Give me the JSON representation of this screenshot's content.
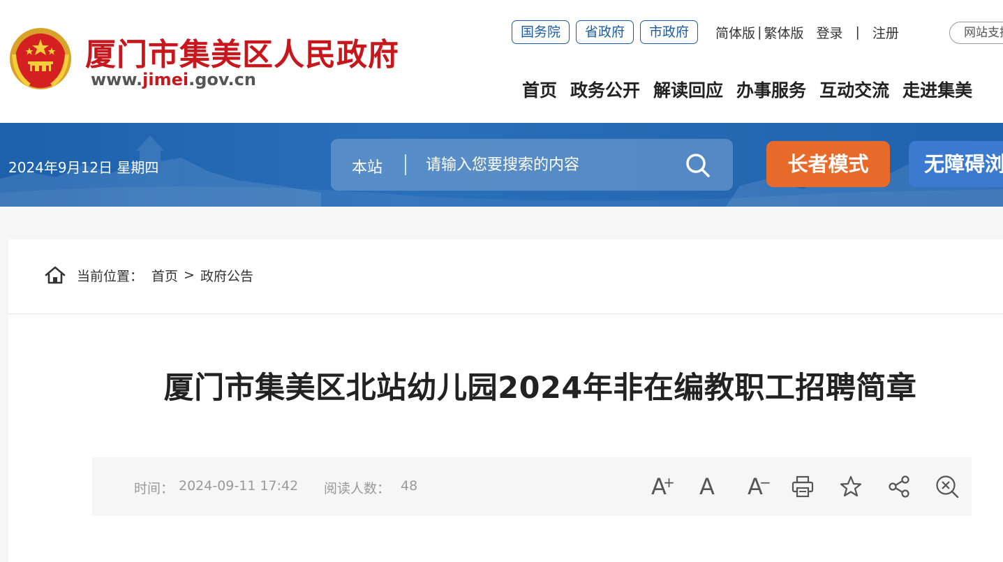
{
  "header": {
    "site_name": "厦门市集美区人民政府",
    "site_url_prefix": "www.",
    "site_url_highlight": "jimei",
    "site_url_suffix": ".gov.cn",
    "gov_links": [
      "国务院",
      "省政府",
      "市政府"
    ],
    "lang_simplified": "简体版",
    "lang_separator": "|",
    "lang_traditional": "繁体版",
    "login": "登录",
    "auth_separator": "|",
    "register": "注册",
    "support": "网站支持",
    "nav": [
      "首页",
      "政务公开",
      "解读回应",
      "办事服务",
      "互动交流",
      "走进集美"
    ]
  },
  "banner": {
    "date": "2024年9月12日 星期四",
    "search_scope": "本站",
    "search_placeholder": "请输入您要搜索的内容",
    "elder_mode": "长者模式",
    "accessibility": "无障碍浏览"
  },
  "breadcrumb": {
    "label": "当前位置：",
    "home": "首页",
    "arrow": ">",
    "current": "政府公告"
  },
  "article": {
    "title": "厦门市集美区北站幼儿园2024年非在编教职工招聘简章",
    "time_label": "时间：",
    "time": "2024-09-11 17:42",
    "read_label": "阅读人数：",
    "read_count": "48"
  },
  "tools": {
    "font_larger": "A",
    "font_larger_sup": "+",
    "font_default": "A",
    "font_smaller": "A",
    "font_smaller_sup": "−"
  },
  "colors": {
    "brand_red": "#c8161d",
    "banner_blue": "#1d61ad",
    "elder_orange": "#e86a2a",
    "access_blue": "#3c7ad0",
    "link_blue": "#1a5ca8"
  }
}
